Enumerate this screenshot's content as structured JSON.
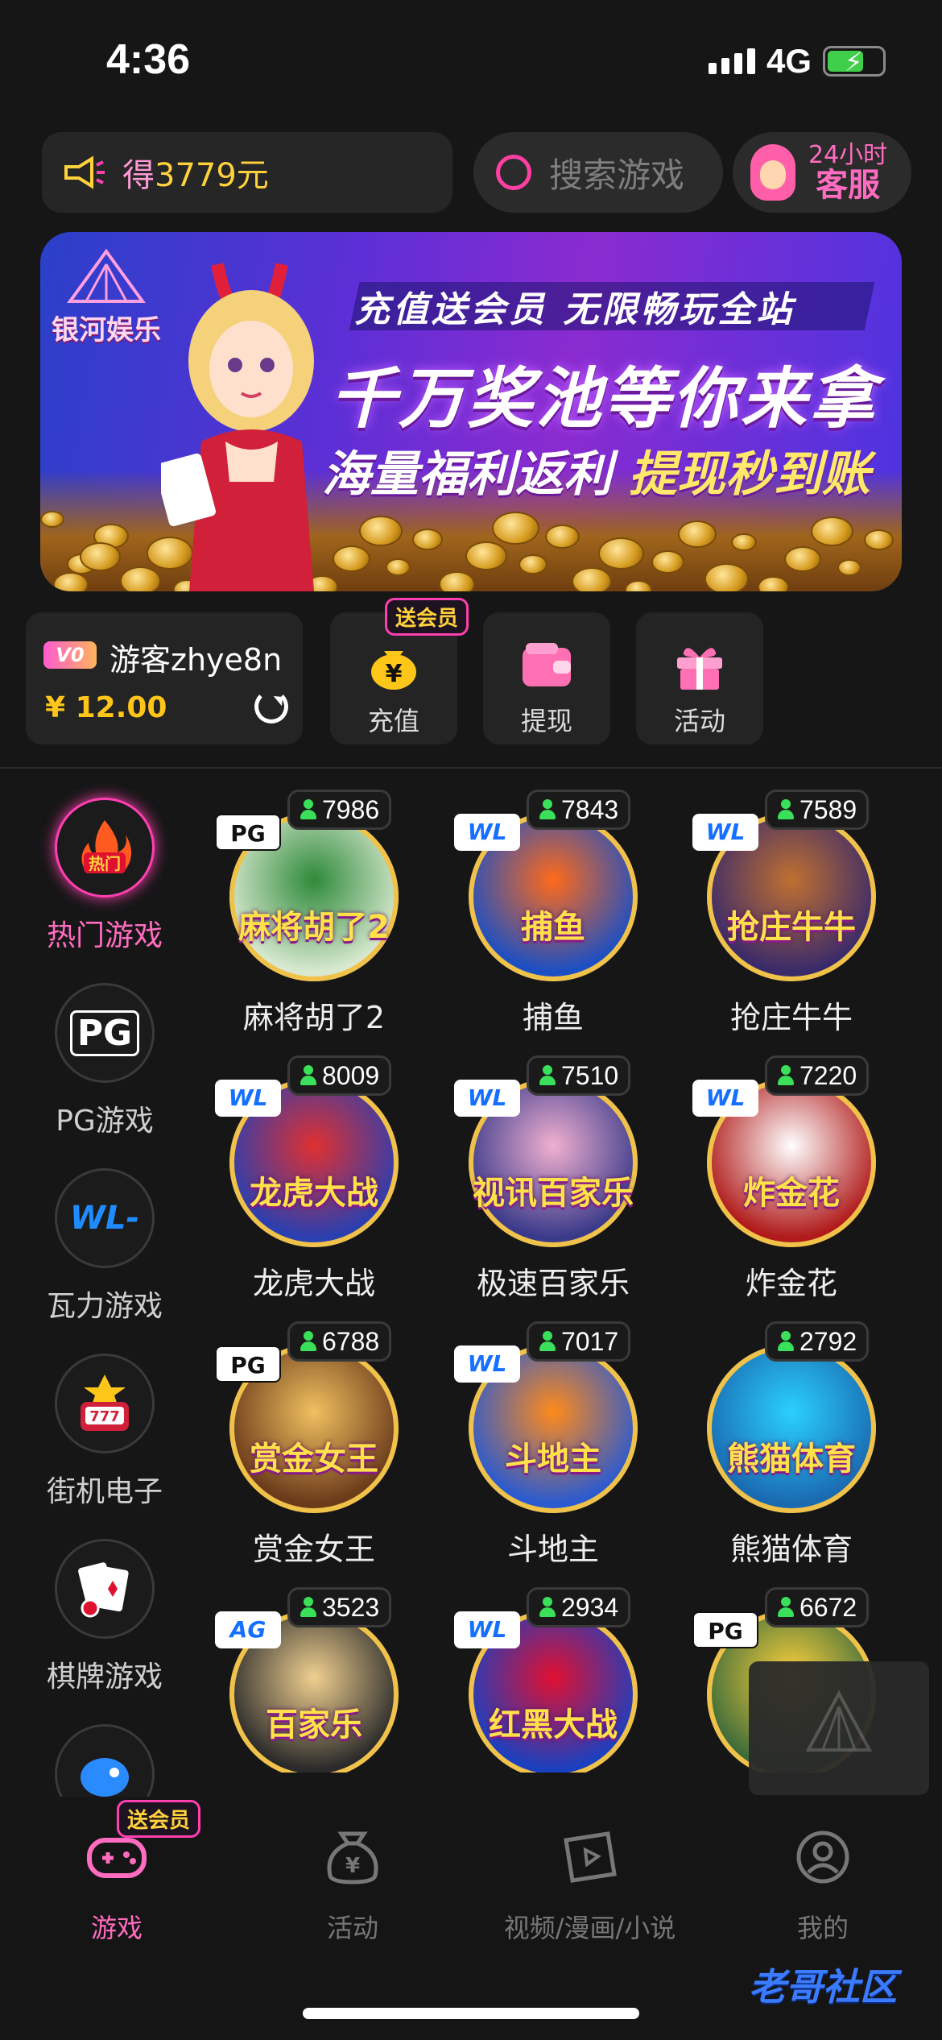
{
  "status_bar": {
    "time": "4:36",
    "network": "4G"
  },
  "header": {
    "notice_prefix": "得",
    "notice_amount": "3779元",
    "search_placeholder": "搜索游戏",
    "support_line1": "24小时",
    "support_line2": "客服"
  },
  "banner": {
    "brand": "银河娱乐",
    "line1": "充值送会员  无限畅玩全站",
    "line2": "千万奖池等你来拿",
    "line3a": "海量福利返利",
    "line3b": "提现秒到账"
  },
  "account": {
    "vip": "V0",
    "username": "游客zhye8n",
    "balance": "¥ 12.00"
  },
  "quick_actions": [
    {
      "label": "充值",
      "tag": "送会员"
    },
    {
      "label": "提现"
    },
    {
      "label": "活动"
    }
  ],
  "categories": [
    {
      "label": "热门游戏",
      "icon": "hot-icon",
      "active": true,
      "badge": "热门"
    },
    {
      "label": "PG游戏",
      "icon": "pg-logo-icon"
    },
    {
      "label": "瓦力游戏",
      "icon": "wl-logo-icon"
    },
    {
      "label": "街机电子",
      "icon": "slot-machine-icon"
    },
    {
      "label": "棋牌游戏",
      "icon": "cards-icon"
    }
  ],
  "games": [
    {
      "name": "麻将胡了2",
      "online": "7986",
      "provider": "PG",
      "art": "麻将胡了2"
    },
    {
      "name": "捕鱼",
      "online": "7843",
      "provider": "WL",
      "art": "捕鱼"
    },
    {
      "name": "抢庄牛牛",
      "online": "7589",
      "provider": "WL",
      "art": "抢庄牛牛"
    },
    {
      "name": "龙虎大战",
      "online": "8009",
      "provider": "WL",
      "art": "龙虎大战"
    },
    {
      "name": "极速百家乐",
      "online": "7510",
      "provider": "WL",
      "art": "视讯百家乐"
    },
    {
      "name": "炸金花",
      "online": "7220",
      "provider": "WL",
      "art": "炸金花"
    },
    {
      "name": "赏金女王",
      "online": "6788",
      "provider": "PG",
      "art": "赏金女王"
    },
    {
      "name": "斗地主",
      "online": "7017",
      "provider": "WL",
      "art": "斗地主"
    },
    {
      "name": "熊猫体育",
      "online": "2792",
      "provider": "",
      "art": "熊猫体育"
    },
    {
      "name": "",
      "online": "3523",
      "provider": "AG",
      "art": "百家乐"
    },
    {
      "name": "",
      "online": "2934",
      "provider": "WL",
      "art": "红黑大战"
    },
    {
      "name": "",
      "online": "6672",
      "provider": "PG",
      "art": ""
    }
  ],
  "tabbar": {
    "tabs": [
      {
        "label": "游戏",
        "tag": "送会员",
        "active": true
      },
      {
        "label": "活动"
      },
      {
        "label": "视频/漫画/小说"
      },
      {
        "label": "我的"
      }
    ]
  },
  "watermark": "老哥社区",
  "colors": {
    "accent": "#ff3fb0",
    "gold": "#ffc61a",
    "bg": "#161616",
    "online": "#3ae05a"
  }
}
